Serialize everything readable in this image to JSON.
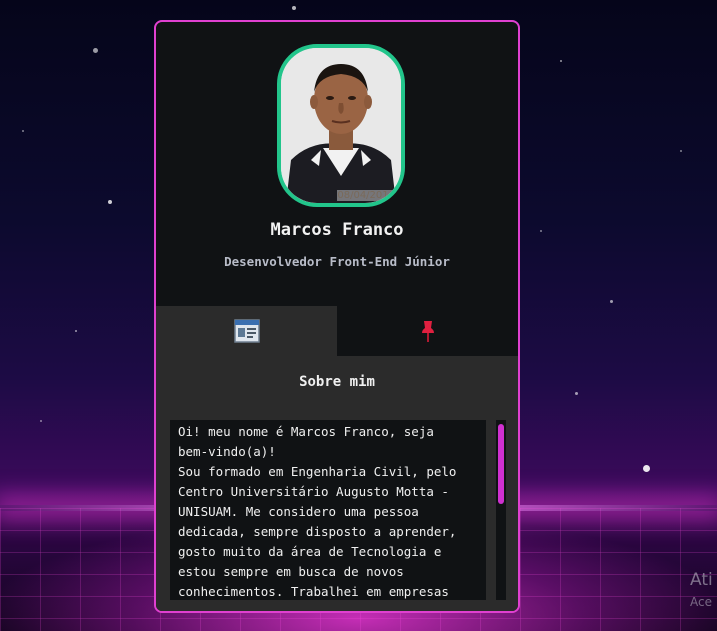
{
  "profile": {
    "name": "Marcos Franco",
    "role": "Desenvolvedor Front-End Júnior",
    "photo_date": "08/04/2014"
  },
  "tabs": [
    {
      "icon": "about-window-icon",
      "active": true
    },
    {
      "icon": "pin-icon",
      "active": false
    }
  ],
  "about": {
    "title": "Sobre mim",
    "text": "Oi! meu nome é Marcos Franco, seja\nbem-vindo(a)!\nSou formado em Engenharia Civil, pelo\nCentro Universitário Augusto Motta -\nUNISUAM. Me considero uma pessoa\ndedicada, sempre disposto a aprender,\ngosto muito da área de Tecnologia e\nestou sempre em busca de novos\nconhecimentos. Trabalhei em empresas"
  },
  "watermark": {
    "line1": "Ati",
    "line2": "Ace"
  },
  "colors": {
    "card_border": "#e040d0",
    "photo_border": "#22c58b",
    "scroll_thumb": "#d030d0",
    "card_bg": "#101214",
    "panel_bg": "#2b2b2b"
  }
}
